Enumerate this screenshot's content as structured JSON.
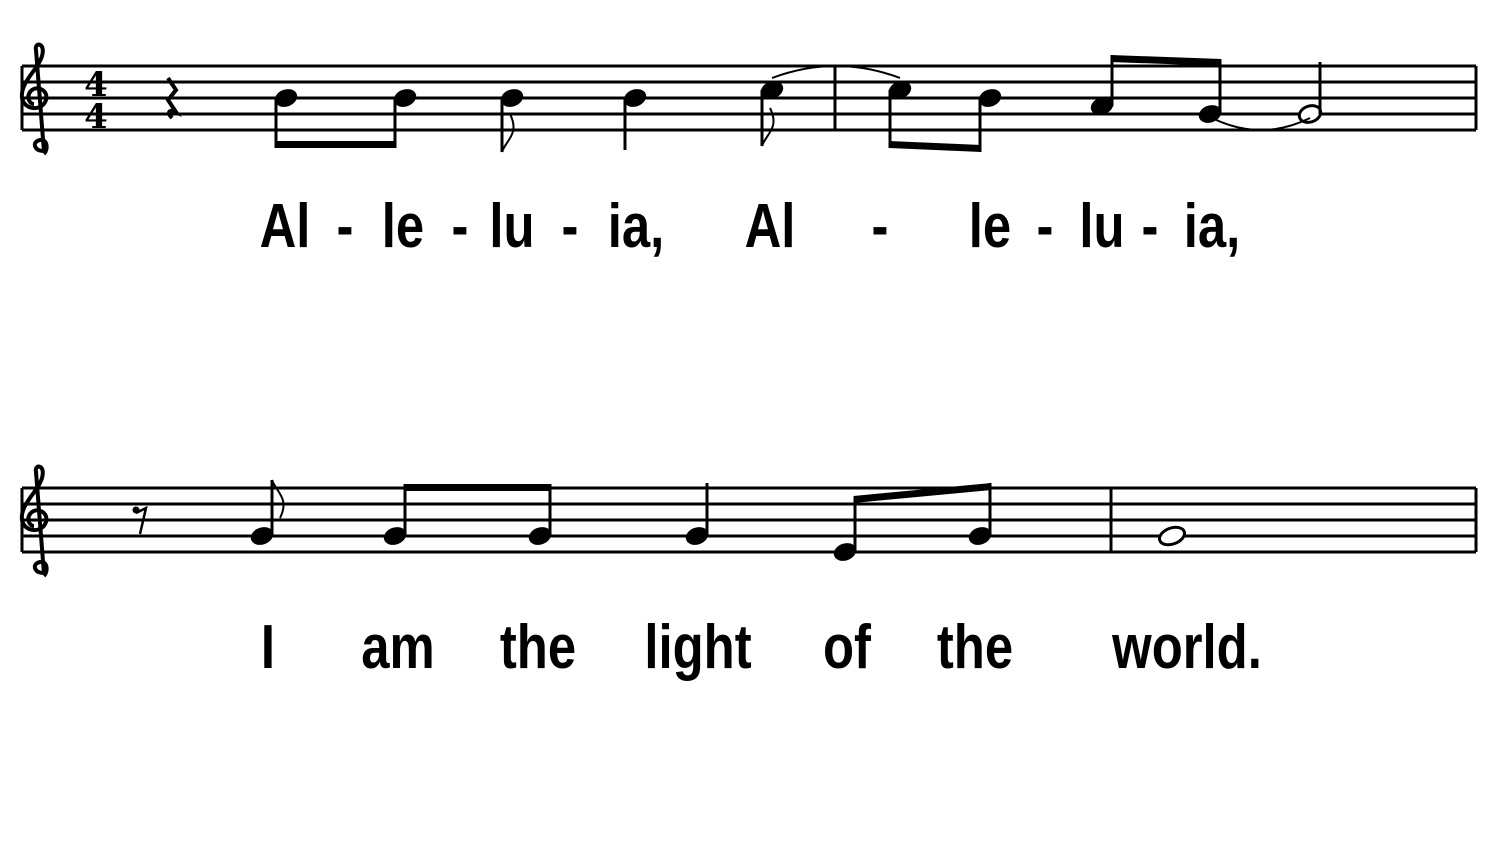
{
  "music": {
    "clef": "treble",
    "time_signature": {
      "top": "4",
      "bottom": "4"
    },
    "colors": {
      "ink": "#000000",
      "background": "#ffffff"
    },
    "systems": [
      {
        "events": [
          {
            "type": "rest",
            "duration": "quarter"
          },
          {
            "type": "note",
            "pitch": "B4",
            "duration": "eighth",
            "beam": 1
          },
          {
            "type": "note",
            "pitch": "B4",
            "duration": "eighth",
            "beam": 1
          },
          {
            "type": "note",
            "pitch": "B4",
            "duration": "eighth"
          },
          {
            "type": "note",
            "pitch": "B4",
            "duration": "quarter"
          },
          {
            "type": "note",
            "pitch": "C5",
            "duration": "eighth",
            "tie_start": true
          },
          {
            "type": "barline"
          },
          {
            "type": "note",
            "pitch": "C5",
            "duration": "eighth",
            "beam": 2,
            "tie_end": true
          },
          {
            "type": "note",
            "pitch": "B4",
            "duration": "eighth",
            "beam": 2
          },
          {
            "type": "note",
            "pitch": "A4",
            "duration": "eighth",
            "beam": 3
          },
          {
            "type": "note",
            "pitch": "G4",
            "duration": "eighth",
            "beam": 3,
            "tie_start": true
          },
          {
            "type": "note",
            "pitch": "G4",
            "duration": "half",
            "tie_end": true
          },
          {
            "type": "barline"
          }
        ],
        "lyrics": [
          "Al",
          "-",
          "le",
          "-",
          "lu",
          "-",
          "ia,",
          "Al",
          "-",
          "le",
          "-",
          "lu",
          "-",
          "ia,"
        ]
      },
      {
        "events": [
          {
            "type": "rest",
            "duration": "eighth"
          },
          {
            "type": "note",
            "pitch": "G4",
            "duration": "eighth"
          },
          {
            "type": "note",
            "pitch": "G4",
            "duration": "eighth",
            "beam": 1
          },
          {
            "type": "note",
            "pitch": "G4",
            "duration": "eighth",
            "beam": 1
          },
          {
            "type": "note",
            "pitch": "G4",
            "duration": "quarter"
          },
          {
            "type": "note",
            "pitch": "E4",
            "duration": "eighth",
            "beam": 2
          },
          {
            "type": "note",
            "pitch": "G4",
            "duration": "eighth",
            "beam": 2
          },
          {
            "type": "barline"
          },
          {
            "type": "note",
            "pitch": "G4",
            "duration": "whole"
          },
          {
            "type": "barline"
          }
        ],
        "lyrics": [
          "I",
          "am",
          "the",
          "light",
          "of",
          "the",
          "world."
        ]
      }
    ]
  }
}
